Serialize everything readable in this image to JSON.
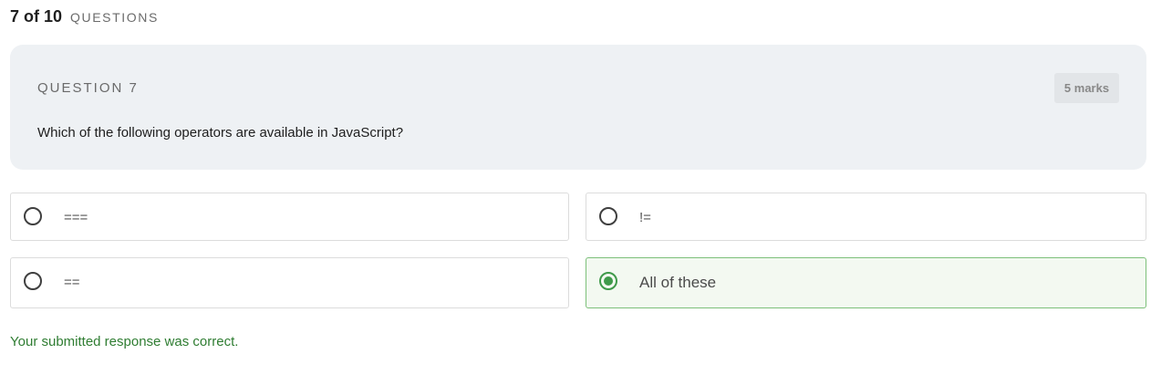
{
  "progress": {
    "count": "7 of 10",
    "label": "QUESTIONS"
  },
  "question": {
    "label": "QUESTION 7",
    "marks": "5 marks",
    "text": "Which of the following operators are available in JavaScript?"
  },
  "options": [
    {
      "text": "===",
      "selected": false
    },
    {
      "text": "!=",
      "selected": false
    },
    {
      "text": "==",
      "selected": false
    },
    {
      "text": "All of these",
      "selected": true
    }
  ],
  "feedback": "Your submitted response was correct.",
  "colors": {
    "correct": "#2f7d32",
    "selected_border": "#7cc07a",
    "selected_bg": "#f3f9f1",
    "card_bg": "#eef1f4"
  }
}
